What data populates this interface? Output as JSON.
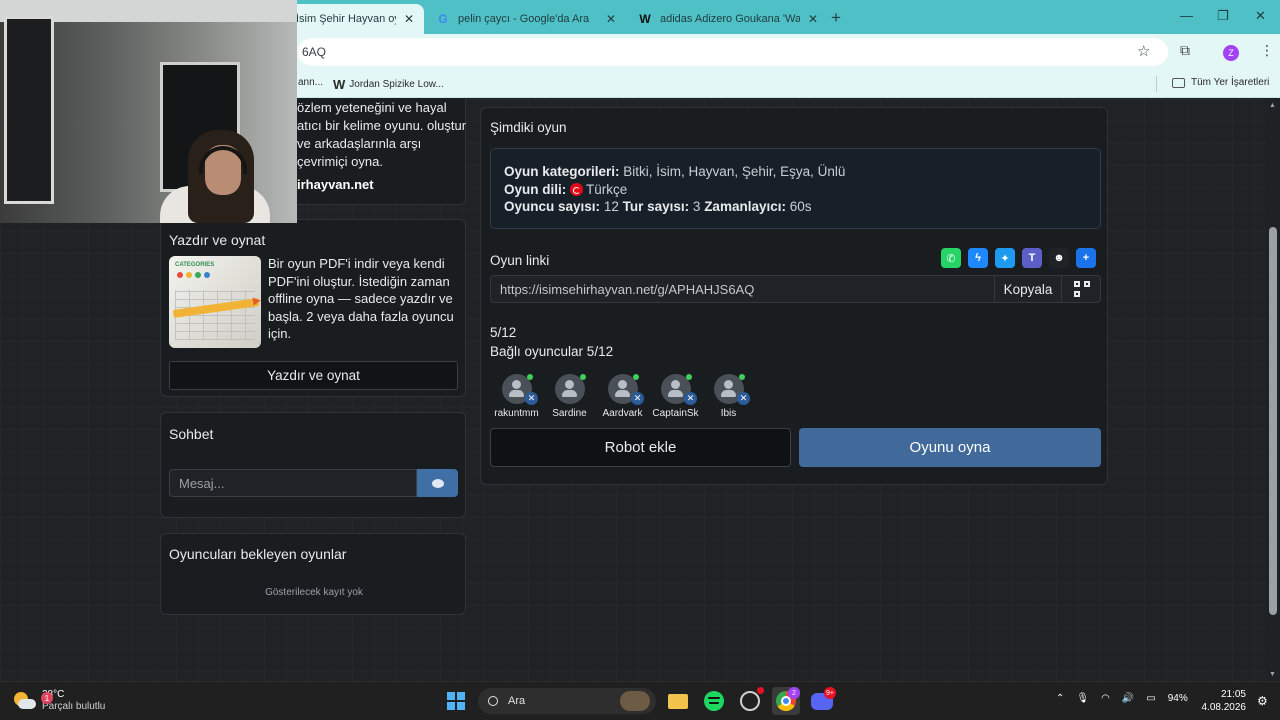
{
  "browser": {
    "tabs": [
      {
        "title": "İsim Şehir Hayvan oyununa katıl",
        "favicon": "",
        "active": true
      },
      {
        "title": "pelin çaycı - Google'da Ara",
        "favicon": "G",
        "active": false
      },
      {
        "title": "adidas Adizero Goukana 'Warm Vivid'",
        "favicon": "W",
        "active": false
      }
    ],
    "url_visible": "6AQ",
    "bookmarks": [
      {
        "label": "ann...",
        "icon": ""
      },
      {
        "label": "Jordan Spizike Low...",
        "icon": "W"
      }
    ],
    "all_bookmarks": "Tüm Yer İşaretleri",
    "profile_initial": "Z"
  },
  "intro": {
    "text": "özlem yeteneğini ve hayal atıcı bir kelime oyunu. oluştur ve arkadaşlarınla arşı çevrimiçi oyna.",
    "site": "irhayvan.net"
  },
  "print": {
    "title": "Yazdır ve oynat",
    "thumb_logo": "CATEGORIES",
    "description": "Bir oyun PDF'i indir veya kendi PDF'ini oluştur. İstediğin zaman offline oyna — sadece yazdır ve başla. 2 veya daha fazla oyuncu için.",
    "button": "Yazdır ve oynat"
  },
  "chat": {
    "title": "Sohbet",
    "placeholder": "Mesaj..."
  },
  "waiting": {
    "title": "Oyuncuları bekleyen oyunlar",
    "empty": "Gösterilecek kayıt yok"
  },
  "game": {
    "title": "Şimdiki oyun",
    "categories_label": "Oyun kategorileri:",
    "categories_value": "Bitki, İsim, Hayvan, Şehir, Eşya, Ünlü",
    "language_label": "Oyun dili:",
    "language_value": "Türkçe",
    "players_label": "Oyuncu sayısı:",
    "players_value": "12",
    "rounds_label": "Tur sayısı:",
    "rounds_value": "3",
    "timer_label": "Zamanlayıcı:",
    "timer_value": "60s",
    "link_label": "Oyun linki",
    "link": "https://isimsehirhayvan.net/g/APHAHJS6AQ",
    "copy": "Kopyala",
    "count": "5/12",
    "connected": "Bağlı oyuncular 5/12",
    "player_names": [
      "rakuntmm",
      "Sardine",
      "Aardvark",
      "CaptainSk",
      "Ibis"
    ],
    "robot_button": "Robot ekle",
    "play_button": "Oyunu oyna",
    "share_colors": {
      "whatsapp": "#25d366",
      "messenger": "#1e88ff",
      "twitter": "#1d9bf0",
      "teams": "#5b5fc7",
      "snapchat": "#1f2327",
      "more": "#1a73e8"
    }
  },
  "taskbar": {
    "temperature": "28°C",
    "weather": "Parçalı bulutlu",
    "weather_badge": "1",
    "search": "Ara",
    "chrome_badge": "2",
    "discord_badge": "9+",
    "battery": "94%",
    "time": "21:05",
    "date": "4.08.2026"
  },
  "colors": {
    "accent": "#41699a",
    "tabbar": "#4fc1c6",
    "page_bg": "#202326"
  }
}
